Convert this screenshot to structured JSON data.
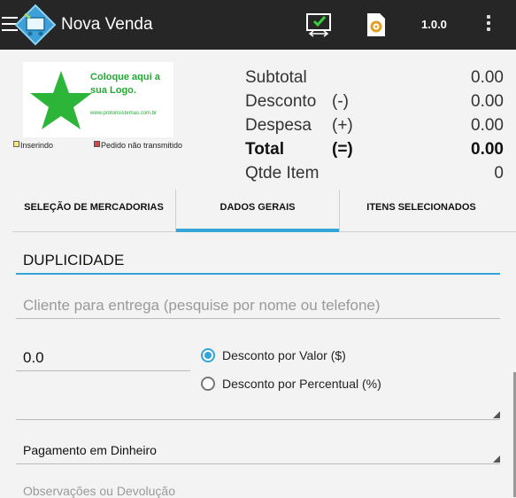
{
  "appbar": {
    "title": "Nova Venda",
    "version": "1.0.0",
    "icons": [
      "menu-icon",
      "app-logo-icon",
      "sync-icon",
      "settings-icon",
      "overflow-menu-icon"
    ]
  },
  "logo": {
    "text": "Coloque aqui a sua Logo.",
    "url": "www.protonsistemas.com.br"
  },
  "status": {
    "inserting": "Inserindo",
    "pending": "Pedido não transmitido"
  },
  "totals": {
    "subtotal": {
      "label": "Subtotal",
      "sign": "",
      "value": "0.00"
    },
    "desconto": {
      "label": "Desconto",
      "sign": "(-)",
      "value": "0.00"
    },
    "despesa": {
      "label": "Despesa",
      "sign": "(+)",
      "value": "0.00"
    },
    "total": {
      "label": "Total",
      "sign": "(=)",
      "value": "0.00"
    },
    "qtde": {
      "label": "Qtde Item",
      "sign": "",
      "value": "0"
    }
  },
  "tabs": [
    {
      "label": "SELEÇÃO DE MERCADORIAS",
      "active": false
    },
    {
      "label": "DADOS GERAIS",
      "active": true
    },
    {
      "label": "ITENS SELECIONADOS",
      "active": false
    }
  ],
  "form": {
    "duplicidade": "DUPLICIDADE",
    "client_placeholder": "Cliente para entrega (pesquise por nome ou telefone)",
    "discount_value": "0.0",
    "radio_valor": "Desconto por Valor ($)",
    "radio_percentual": "Desconto por Percentual (%)",
    "radio_selected": "valor",
    "empty_spinner": "",
    "payment": "Pagamento em Dinheiro",
    "obs_partial": "Observações ou Devolução"
  },
  "colors": {
    "appbar": "#262626",
    "accent": "#33a5d6",
    "logo_green": "#22aa33",
    "background": "#f3f3f3"
  }
}
